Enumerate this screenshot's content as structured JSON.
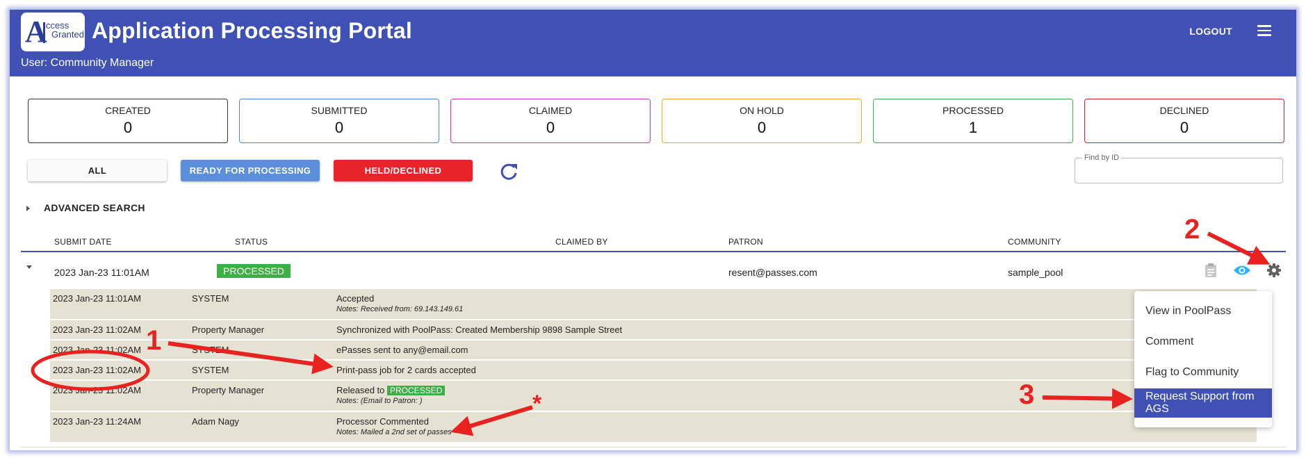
{
  "header": {
    "title": "Application Processing Portal",
    "user": "User: Community Manager",
    "logout": "LOGOUT",
    "logo_text_1": "ccess",
    "logo_text_2": "Granted"
  },
  "stats": [
    {
      "label": "CREATED",
      "value": "0",
      "color": "#333333"
    },
    {
      "label": "SUBMITTED",
      "value": "0",
      "color": "#4a86e8"
    },
    {
      "label": "CLAIMED",
      "value": "0",
      "color": "#d930c8"
    },
    {
      "label": "ON HOLD",
      "value": "0",
      "color": "#f5a623"
    },
    {
      "label": "PROCESSED",
      "value": "1",
      "color": "#3cb043"
    },
    {
      "label": "DECLINED",
      "value": "0",
      "color": "#e02020"
    }
  ],
  "filters": {
    "all": "ALL",
    "ready": "READY FOR PROCESSING",
    "held": "HELD/DECLINED"
  },
  "find_label": "Find by ID",
  "advanced_search": "ADVANCED SEARCH",
  "table": {
    "headers": {
      "submit_date": "SUBMIT DATE",
      "status": "STATUS",
      "claimed_by": "CLAIMED BY",
      "patron": "PATRON",
      "community": "COMMUNITY"
    },
    "row": {
      "submit_date": "2023 Jan-23 11:01AM",
      "status": "PROCESSED",
      "patron": "resent@passes.com",
      "community": "sample_pool"
    },
    "history": [
      {
        "date": "2023 Jan-23 11:01AM",
        "actor": "SYSTEM",
        "text": "Accepted",
        "note": "Notes: Received from: 69.143.149.61"
      },
      {
        "date": "2023 Jan-23 11:02AM",
        "actor": "Property Manager",
        "text": "Synchronized with PoolPass: Created Membership 9898 Sample Street",
        "note": ""
      },
      {
        "date": "2023 Jan-23 11:02AM",
        "actor": "SYSTEM",
        "text": "ePasses sent to any@email.com",
        "note": ""
      },
      {
        "date": "2023 Jan-23 11:02AM",
        "actor": "SYSTEM",
        "text": "Print-pass job for 2 cards accepted",
        "note": ""
      },
      {
        "date": "2023 Jan-23 11:02AM",
        "actor": "Property Manager",
        "text": "Released to",
        "badge": "PROCESSED",
        "note": "Notes: (Email to Patron: )"
      },
      {
        "date": "2023 Jan-23 11:24AM",
        "actor": "Adam Nagy",
        "text": "Processor Commented",
        "note": "Notes: Mailed a 2nd set of passes"
      }
    ]
  },
  "menu": {
    "items": [
      "View in PoolPass",
      "Comment",
      "Flag to Community",
      "Request Support from AGS"
    ]
  },
  "annotations": {
    "n1": "1",
    "n2": "2",
    "n3": "3",
    "star": "*"
  },
  "colors": {
    "primary": "#3f51b5",
    "ready_button": "#5b8fd9",
    "held_button": "#e8232a",
    "processed": "#3cb043",
    "history_bg": "#e6e2d3",
    "annotation": "#e8231f"
  }
}
